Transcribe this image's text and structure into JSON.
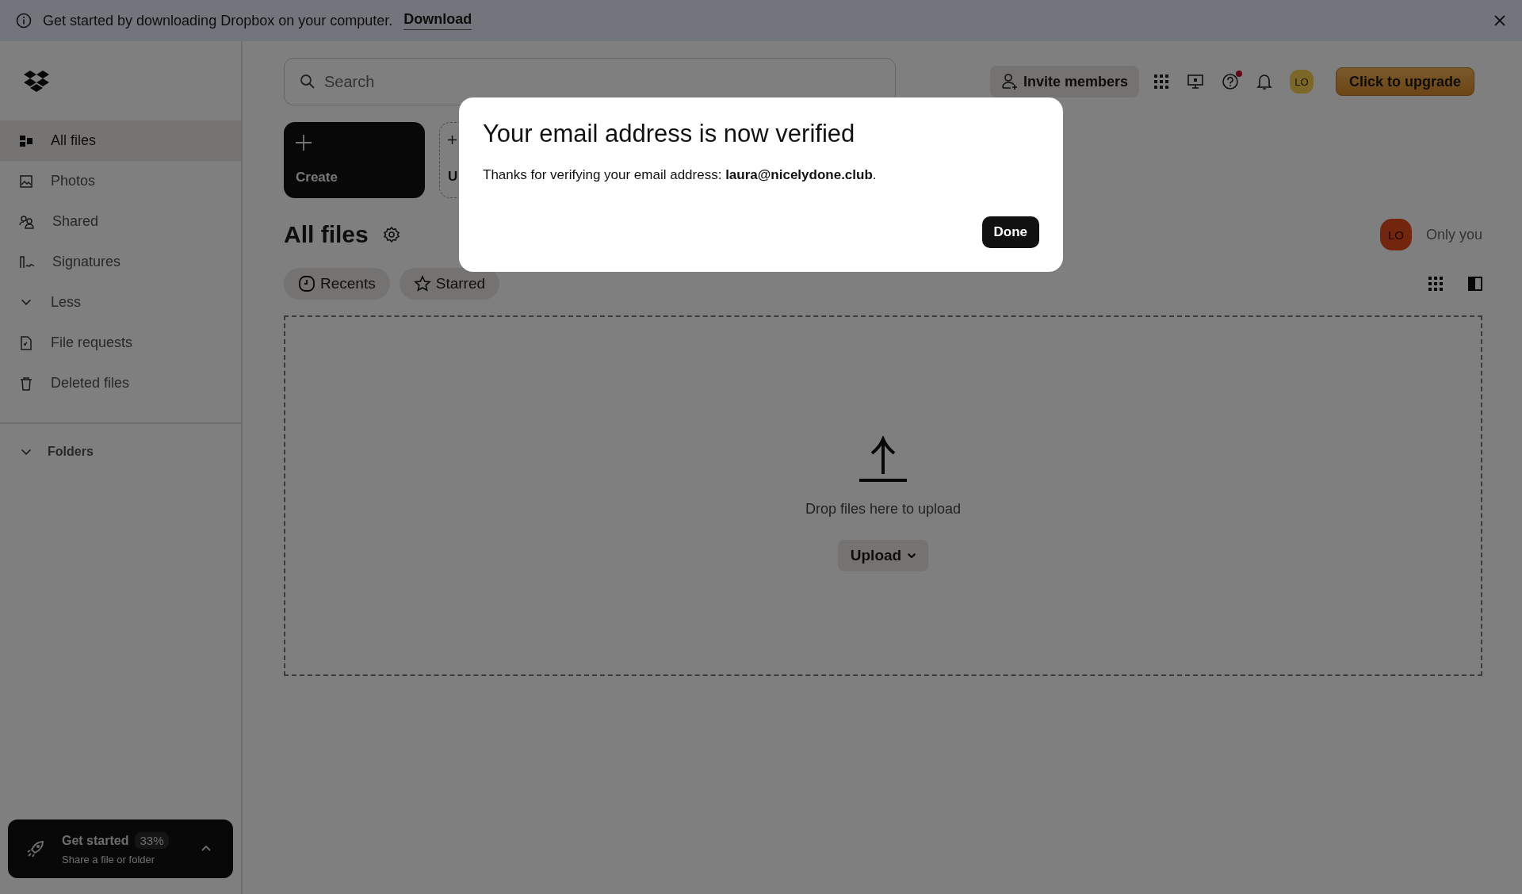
{
  "banner": {
    "text": "Get started by downloading Dropbox on your computer.",
    "link": "Download"
  },
  "sidebar": {
    "items": [
      {
        "label": "All files",
        "kind": "files",
        "selected": true
      },
      {
        "label": "Photos",
        "kind": "photos",
        "selected": false
      },
      {
        "label": "Shared",
        "kind": "shared",
        "selected": false
      },
      {
        "label": "Signatures",
        "kind": "signatures",
        "selected": false
      },
      {
        "label": "Less",
        "kind": "toggle",
        "selected": false
      },
      {
        "label": "File requests",
        "kind": "requests",
        "selected": false
      },
      {
        "label": "Deleted files",
        "kind": "deleted",
        "selected": false
      }
    ],
    "folders": "Folders",
    "get_started": {
      "title": "Get started",
      "percent": "33%",
      "subtitle": "Share a file or folder"
    }
  },
  "header": {
    "search": {
      "placeholder": "Search"
    },
    "invite": "Invite members",
    "help_notification": true,
    "avatar": "LO",
    "upgrade": "Click to upgrade"
  },
  "actions": [
    {
      "label": "Create"
    },
    {
      "label": "U"
    }
  ],
  "page": {
    "title": "All files",
    "share_avatar": "LO",
    "share_text": "Only you"
  },
  "filters": [
    {
      "label": "Recents",
      "kind": "clock"
    },
    {
      "label": "Starred",
      "kind": "star"
    }
  ],
  "dropzone": {
    "text": "Drop files here to upload",
    "button": "Upload"
  },
  "modal": {
    "title": "Your email address is now verified",
    "body": "Thanks for verifying your email address: **laura@nicelydone.club**.",
    "button": "Done"
  }
}
